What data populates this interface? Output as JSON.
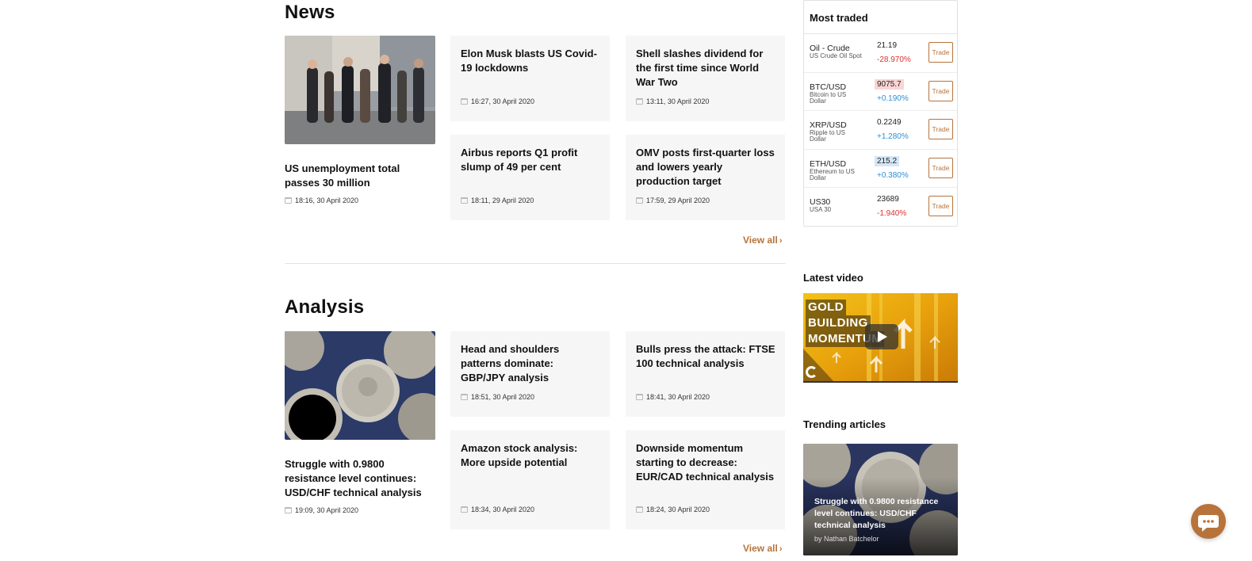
{
  "news": {
    "title": "News",
    "feature": {
      "title": "US unemployment total passes 30 million",
      "date": "18:16, 30 April 2020"
    },
    "cards": [
      {
        "title": "Elon Musk blasts US Covid-19 lockdowns",
        "date": "16:27, 30 April 2020"
      },
      {
        "title": "Shell slashes dividend for the first time since World War Two",
        "date": "13:11, 30 April 2020"
      },
      {
        "title": "Airbus reports Q1 profit slump of 49 per cent",
        "date": "18:11, 29 April 2020"
      },
      {
        "title": "OMV posts first-quarter loss and lowers yearly production target",
        "date": "17:59, 29 April 2020"
      }
    ],
    "view_all": "View all"
  },
  "analysis": {
    "title": "Analysis",
    "feature": {
      "title": "Struggle with 0.9800 resistance level continues: USD/CHF technical analysis",
      "date": "19:09, 30 April 2020"
    },
    "cards": [
      {
        "title": "Head and shoulders patterns dominate: GBP/JPY analysis",
        "date": "18:51, 30 April 2020"
      },
      {
        "title": "Bulls press the attack: FTSE 100 technical analysis",
        "date": "18:41, 30 April 2020"
      },
      {
        "title": "Amazon stock analysis: More upside potential",
        "date": "18:34, 30 April 2020"
      },
      {
        "title": "Downside momentum starting to decrease: EUR/CAD technical analysis",
        "date": "18:24, 30 April 2020"
      }
    ],
    "view_all": "View all"
  },
  "most_traded": {
    "title": "Most traded",
    "trade_label": "Trade",
    "rows": [
      {
        "symbol": "Oil - Crude",
        "name": "US Crude Oil Spot",
        "price": "21.19",
        "change": "-28.970%",
        "direction": "neg",
        "highlight": "none"
      },
      {
        "symbol": "BTC/USD",
        "name": "Bitcoin to US Dollar",
        "price": "9075.7",
        "change": "+0.190%",
        "direction": "pos",
        "highlight": "red"
      },
      {
        "symbol": "XRP/USD",
        "name": "Ripple to US Dollar",
        "price": "0.2249",
        "change": "+1.280%",
        "direction": "pos",
        "highlight": "none"
      },
      {
        "symbol": "ETH/USD",
        "name": "Ethereum to US Dollar",
        "price": "215.2",
        "change": "+0.380%",
        "direction": "pos",
        "highlight": "blue"
      },
      {
        "symbol": "US30",
        "name": "USA 30",
        "price": "23689",
        "change": "-1.940%",
        "direction": "neg",
        "highlight": "none"
      }
    ]
  },
  "latest_video": {
    "title": "Latest video",
    "overlay_lines": [
      "GOLD",
      "BUILDING",
      "MOMENTUM"
    ]
  },
  "trending": {
    "title": "Trending articles",
    "article_title": "Struggle with 0.9800 resistance level continues: USD/CHF technical analysis",
    "author": "by Nathan Batchelor"
  },
  "colors": {
    "accent": "#b7733a",
    "negative": "#e03030",
    "positive": "#2b8fd6",
    "card_bg": "#f6f6f6"
  },
  "icons": {
    "date": "calendar-icon",
    "chat": "chat-bubble-icon",
    "play": "play-icon",
    "view_all": "chevron-right-icon"
  }
}
